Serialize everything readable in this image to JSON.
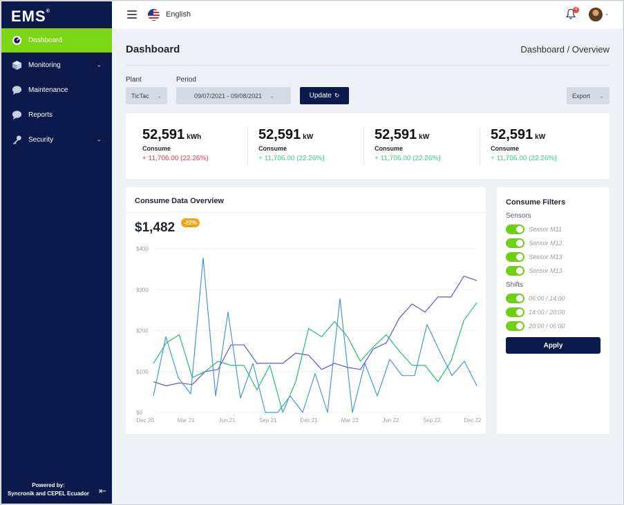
{
  "app": {
    "logo": "EMS",
    "logo_mark": "®"
  },
  "sidebar": {
    "items": [
      {
        "label": "Dashboard",
        "icon": "dashboard-icon",
        "active": true
      },
      {
        "label": "Monitoring",
        "icon": "cube-icon",
        "has_children": true
      },
      {
        "label": "Maintenance",
        "icon": "chat-icon"
      },
      {
        "label": "Reports",
        "icon": "chat-icon"
      },
      {
        "label": "Security",
        "icon": "key-icon",
        "has_children": true
      }
    ],
    "powered_line1": "Powered by:",
    "powered_line2": "Syncronik and CEPEL Ecuador"
  },
  "topbar": {
    "language": "English",
    "notifications": "4"
  },
  "page": {
    "title": "Dashboard",
    "breadcrumb": "Dashboard / Overview"
  },
  "filters_bar": {
    "plant_label": "Plant",
    "plant_value": "TicTac",
    "period_label": "Period",
    "period_value": "09/07/2021 - 09/08/2021",
    "update_label": "Update",
    "export_label": "Export"
  },
  "stats": [
    {
      "value": "52,591",
      "unit": "kWh",
      "name": "Consume",
      "change": "+ 11,706.00 (22.26%)",
      "change_color": "#e0454b"
    },
    {
      "value": "52,591",
      "unit": "kW",
      "name": "Consume",
      "change": "+ 11,706.00 (22.26%)",
      "change_color": "#3fcf7a"
    },
    {
      "value": "52,591",
      "unit": "kW",
      "name": "Consume",
      "change": "+ 11,706.00 (22.26%)",
      "change_color": "#3fcf7a"
    },
    {
      "value": "52,591",
      "unit": "kW",
      "name": "Consume",
      "change": "+ 11,706.00 (22.26%)",
      "change_color": "#3fcf7a"
    }
  ],
  "chart_panel": {
    "title": "Consume Data Overview",
    "total": "$1,482",
    "badge": "-22%"
  },
  "chart_data": {
    "type": "line",
    "x": [
      "Dec 20",
      "",
      "",
      "",
      "",
      "",
      "Mar 21",
      "",
      "",
      "",
      "",
      "",
      "Jun 21",
      "",
      "",
      "",
      "",
      "",
      "Sep 21",
      "",
      "",
      "",
      "",
      "",
      "Dec 21",
      "",
      "",
      "",
      "",
      "",
      "Mar 22",
      "",
      "",
      "",
      "",
      "",
      "Jun 22",
      "",
      "",
      "",
      "",
      "",
      "Sep 22",
      "",
      "",
      "",
      "",
      "",
      "Dec 22",
      "",
      ""
    ],
    "xtick_labels": [
      "Dec 20",
      "Mar 21",
      "Jun 21",
      "Sep 21",
      "Dec 21",
      "Mar 22",
      "Jun 22",
      "Sep 22",
      "Dec 22"
    ],
    "ytick_labels": [
      "$0",
      "$100",
      "$200",
      "$300",
      "$400"
    ],
    "ylim": [
      0,
      400
    ],
    "grid": true,
    "colors": [
      "#5b55d6",
      "#1fbf6a",
      "#4a93dd"
    ],
    "series": [
      {
        "values": [
          75,
          65,
          72,
          68,
          100,
          105,
          165,
          165,
          120,
          120,
          120,
          145,
          140,
          105,
          120,
          110,
          105,
          155,
          170,
          230,
          265,
          245,
          282,
          282,
          333,
          322
        ]
      },
      {
        "values": [
          120,
          170,
          190,
          85,
          100,
          125,
          115,
          115,
          55,
          115,
          0,
          75,
          205,
          185,
          222,
          185,
          125,
          160,
          190,
          150,
          115,
          115,
          75,
          125,
          225,
          268
        ]
      },
      {
        "values": [
          40,
          185,
          85,
          45,
          378,
          40,
          245,
          35,
          120,
          0,
          0,
          40,
          0,
          95,
          0,
          278,
          0,
          120,
          40,
          130,
          90,
          90,
          215,
          150,
          90,
          125,
          65
        ]
      }
    ]
  },
  "filter_panel": {
    "title": "Consume Filters",
    "sensors_label": "Sensors",
    "sensors": [
      "Sensor M11",
      "Sensor M12",
      "Sensor M13",
      "Sensor M13"
    ],
    "shifts_label": "Shifts",
    "shifts": [
      "06:00 / 14:00",
      "14:00 / 20:00",
      "20:00 / 06:00"
    ],
    "apply_label": "Apply"
  }
}
